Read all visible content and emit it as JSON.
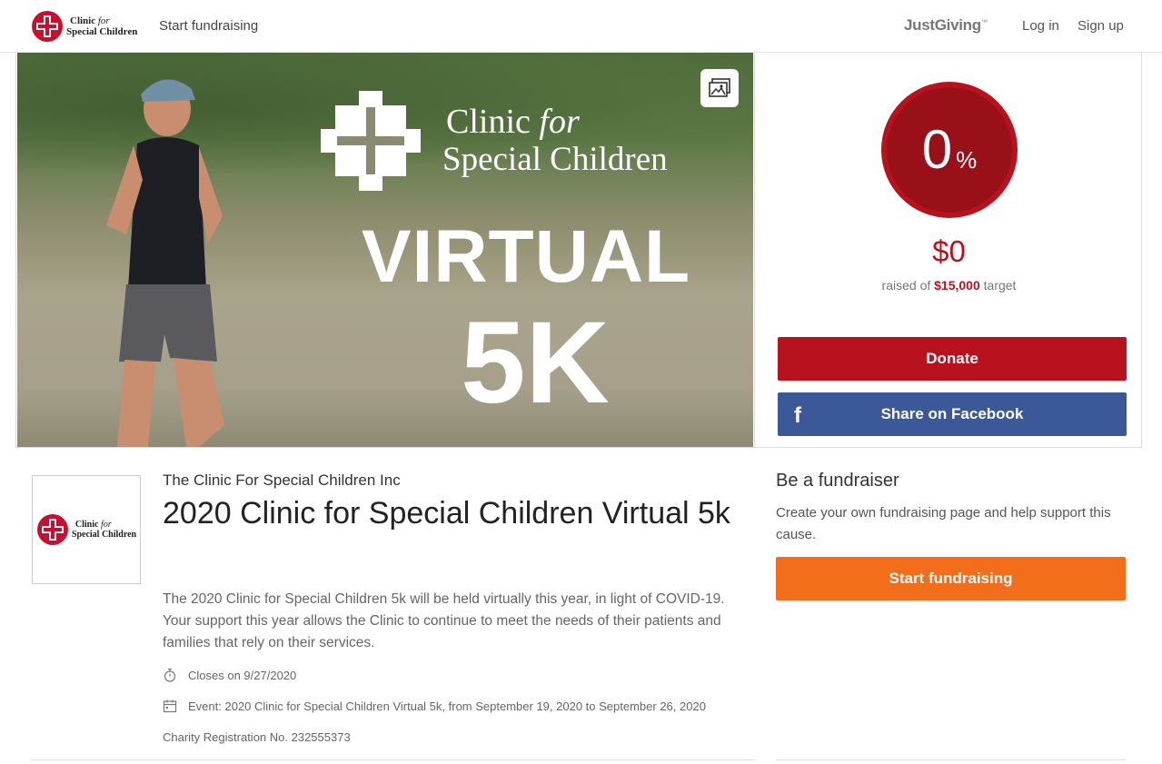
{
  "header": {
    "logo_line1_a": "Clinic",
    "logo_line1_b": "for",
    "logo_line2": "Special Children",
    "start_fundraising": "Start fundraising",
    "brand": "JustGiving",
    "brand_mark": "™",
    "login": "Log in",
    "signup": "Sign up"
  },
  "hero": {
    "overlay_line1_a": "Clinic",
    "overlay_line1_b": "for",
    "overlay_line2": "Special Children",
    "headline": "VIRTUAL",
    "subheadline": "5K",
    "gallery_icon": "image-gallery-icon"
  },
  "progress": {
    "percent": "0",
    "percent_sign": "%",
    "percent_value": 0,
    "raised": "$0",
    "raised_prefix": "raised of",
    "target_amount": "$15,000",
    "target_suffix": "target",
    "donate_label": "Donate",
    "facebook_label": "Share on Facebook",
    "facebook_icon": "f"
  },
  "details": {
    "charity_name": "The Clinic For Special Children Inc",
    "title": "2020 Clinic for Special Children Virtual 5k",
    "description": "The 2020 Clinic for Special Children 5k will be held virtually this year, in light of COVID-19. Your support this year allows the Clinic to continue to meet the needs of their patients and families that rely on their services.",
    "closes": "Closes on 9/27/2020",
    "event": "Event: 2020 Clinic for Special Children Virtual 5k, from September 19, 2020 to September 26, 2020",
    "registration": "Charity Registration No. 232555373"
  },
  "fundraiser": {
    "title": "Be a fundraiser",
    "description": "Create your own fundraising page and help support this cause.",
    "button": "Start fundraising"
  },
  "colors": {
    "brand_red": "#b8121f",
    "facebook_blue": "#3b5998",
    "orange": "#f36e1a"
  }
}
